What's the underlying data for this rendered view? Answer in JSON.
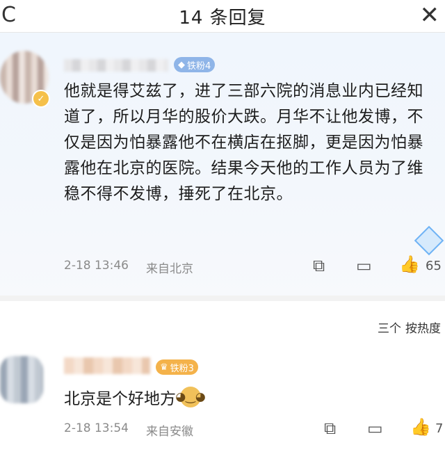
{
  "header": {
    "title": "14 条回复",
    "refresh_icon": "C",
    "close_icon": "✕"
  },
  "main_comment": {
    "fan_badge": "铁粉4",
    "text": "他就是得艾兹了，进了三部六院的消息业内已经知道了，所以月华的股价大跌。月华不让他发博，不仅是因为怕暴露他不在横店在抠脚，更是因为怕暴露他在北京的医院。结果今天他的工作人员为了维稳不得不发博，捶死了在北京。",
    "time": "2-18 13:46",
    "location": "来自北京",
    "like_count": "65"
  },
  "sort": {
    "label": "按热度",
    "icon": "三个"
  },
  "reply": {
    "fan_badge": "铁粉3",
    "text": "北京是个好地方",
    "time": "2-18 13:54",
    "location": "来自安徽",
    "like_count": "7"
  },
  "icons": {
    "share": "share-icon",
    "comment": "comment-icon",
    "like": "thumbs-up-icon"
  },
  "colors": {
    "comment_bg": "#f0f6fd",
    "fan_badge_blue": "#8fb5e8",
    "fan_badge_orange": "#f4b24a"
  }
}
